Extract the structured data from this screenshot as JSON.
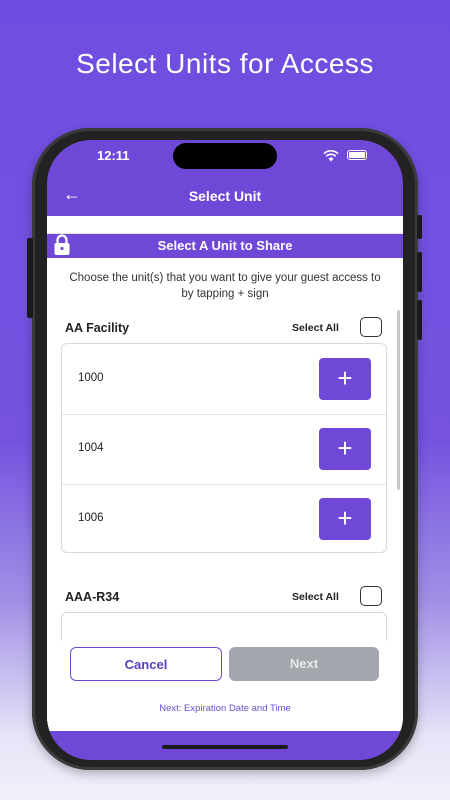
{
  "headline": "Select Units for Access",
  "status_bar": {
    "time": "12:11",
    "wifi_icon": "wifi-icon",
    "battery_icon": "battery-icon"
  },
  "nav": {
    "back_icon": "arrow-left-icon",
    "title": "Select Unit"
  },
  "banner": {
    "lock_icon": "lock-icon",
    "title": "Select A Unit to Share"
  },
  "instructions": "Choose the unit(s) that you want to give your guest access to by tapping + sign",
  "groups": [
    {
      "name": "AA Facility",
      "select_all_label": "Select All",
      "units": [
        {
          "label": "1000",
          "action": "+"
        },
        {
          "label": "1004",
          "action": "+"
        },
        {
          "label": "1006",
          "action": "+"
        }
      ]
    },
    {
      "name": "AAA-R34",
      "select_all_label": "Select All",
      "units": []
    }
  ],
  "footer": {
    "cancel_label": "Cancel",
    "next_label": "Next",
    "next_hint": "Next: Expiration Date and Time"
  },
  "colors": {
    "primary": "#7048d8",
    "disabled_button": "#a3a6ad",
    "background": "#6f4de0"
  }
}
